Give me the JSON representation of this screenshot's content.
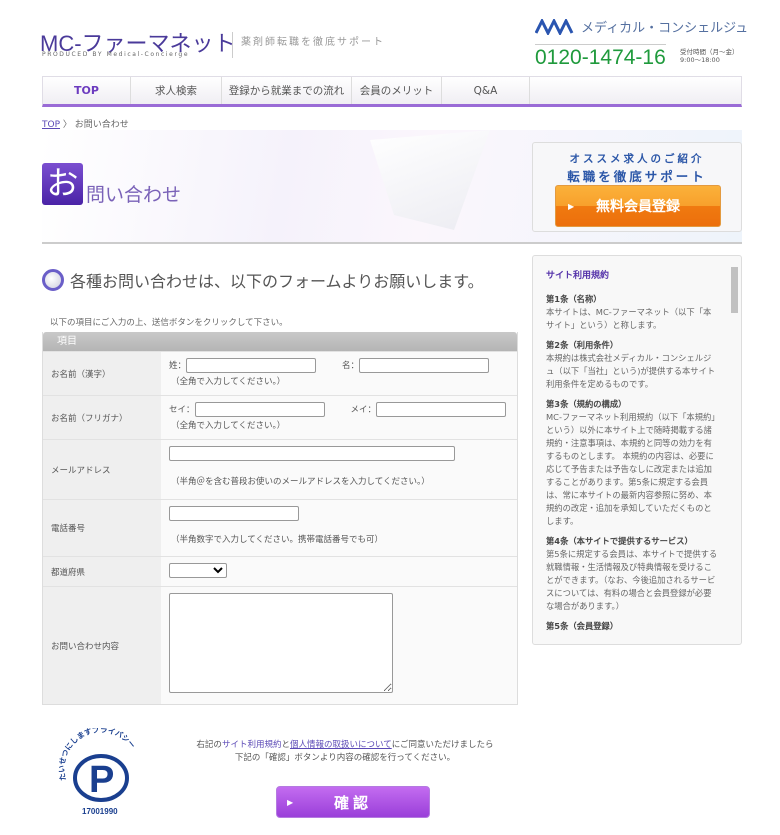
{
  "header": {
    "logo": "MC-ファーマネット",
    "logo_sub": "PRODUCED BY Medical-Concierge",
    "tagline": "薬剤師転職を徹底サポート",
    "company": "メディカル・コンシェルジュ",
    "phone": "0120-1474-16",
    "hours_label": "受付時間（月〜金）",
    "hours": "9:00〜18:00",
    "phone_color": "#1f9a3c",
    "accent": "#9a6bd6"
  },
  "nav": [
    {
      "label": "TOP"
    },
    {
      "label": "求人検索"
    },
    {
      "label": "登録から就業までの流れ"
    },
    {
      "label": "会員のメリット"
    },
    {
      "label": "Q&A"
    }
  ],
  "breadcrumb": {
    "home": "TOP",
    "sep": "〉",
    "current": "お問い合わせ"
  },
  "hero": {
    "initial": "お",
    "title": "問い合わせ"
  },
  "banner": {
    "line1": "オススメ求人のご紹介",
    "line2": "転職を徹底サポート",
    "button": "無料会員登録"
  },
  "main": {
    "heading": "各種お問い合わせは、以下のフォームよりお願いします。",
    "intro": "以下の項目にご入力の上、送信ボタンをクリックして下さい。"
  },
  "form": {
    "header": "項目",
    "name_kanji": {
      "label": "お名前（漢字）",
      "last": "姓：",
      "first": "名：",
      "note": "（全角で入力してください。）",
      "last_value": "",
      "first_value": ""
    },
    "name_kana": {
      "label": "お名前（フリガナ）",
      "last": "セイ：",
      "first": "メイ：",
      "note": "（全角で入力してください。）",
      "last_value": "",
      "first_value": ""
    },
    "email": {
      "label": "メールアドレス",
      "note": "（半角＠を含む普段お使いのメールアドレスを入力してください。）",
      "value": ""
    },
    "phone": {
      "label": "電話番号",
      "note": "（半角数字で入力してください。携帯電話番号でも可）",
      "value": ""
    },
    "prefecture": {
      "label": "都道府県",
      "selected": ""
    },
    "content": {
      "label": "お問い合わせ内容",
      "value": ""
    }
  },
  "terms": {
    "title": "サイト利用規約",
    "articles": [
      {
        "h": "第1条（名称）",
        "b": "本サイトは、MC-ファーマネット（以下「本サイト」という）と称します。"
      },
      {
        "h": "第2条（利用条件）",
        "b": "本規約は株式会社メディカル・コンシェルジュ（以下「当社」という)が提供する本サイト利用条件を定めるものです。"
      },
      {
        "h": "第3条（規約の構成）",
        "b": "MC-ファーマネット利用規約（以下「本規約」という）以外に本サイト上で随時掲載する諸規約・注意事項は、本規約と同等の効力を有するものとします。 本規約の内容は、必要に応じて予告または予告なしに改定または追加することがあります。第5条に規定する会員は、常に本サイトの最新内容参照に努め、本規約の改定・追加を承知していただくものとします。"
      },
      {
        "h": "第4条（本サイトで提供するサービス）",
        "b": "第5条に規定する会員は、本サイトで提供する就職情報・生活情報及び特典情報を受けることができます。（なお、今後追加されるサービスについては、有料の場合と会員登録が必要な場合があります。）"
      },
      {
        "h": "第5条（会員登録）",
        "b": ""
      }
    ]
  },
  "footer": {
    "privacy_number": "17001990",
    "privacy_text": "たいせつにしますプライバシー",
    "agree_pre": "右記の",
    "terms_link": "サイト利用規約",
    "and": "と",
    "privacy_link": "個人情報の取扱いについて",
    "agree_post": "にご同意いただけましたら",
    "agree_line2": "下記の「確認」ボタンより内容の確認を行ってください。",
    "confirm": "確認"
  }
}
